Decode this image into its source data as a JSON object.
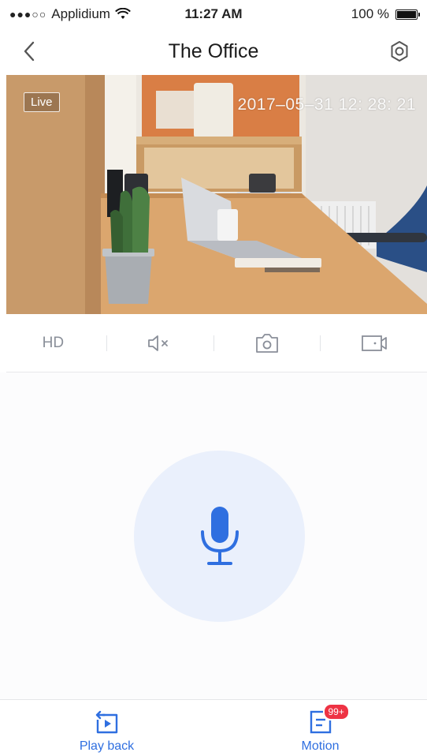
{
  "status_bar": {
    "signal": "●●●○○",
    "carrier": "Applidium",
    "time": "11:27 AM",
    "battery_text": "100 %",
    "battery_level": 1.0
  },
  "nav": {
    "title": "The Office",
    "back_icon": "chevron-left-icon",
    "settings_icon": "gear-icon"
  },
  "video": {
    "live_label": "Live",
    "timestamp": "2017–05–31 12: 28: 21"
  },
  "controls": {
    "hd_label": "HD",
    "mute_icon": "speaker-muted-icon",
    "snapshot_icon": "camera-icon",
    "record_icon": "video-record-icon"
  },
  "mic": {
    "icon": "microphone-icon",
    "accent_color": "#2f6fe0",
    "circle_color": "#eaf0fc"
  },
  "tabs": [
    {
      "label": "Play back",
      "icon": "playback-icon"
    },
    {
      "label": "Motion",
      "icon": "motion-list-icon",
      "badge": "99+"
    }
  ]
}
